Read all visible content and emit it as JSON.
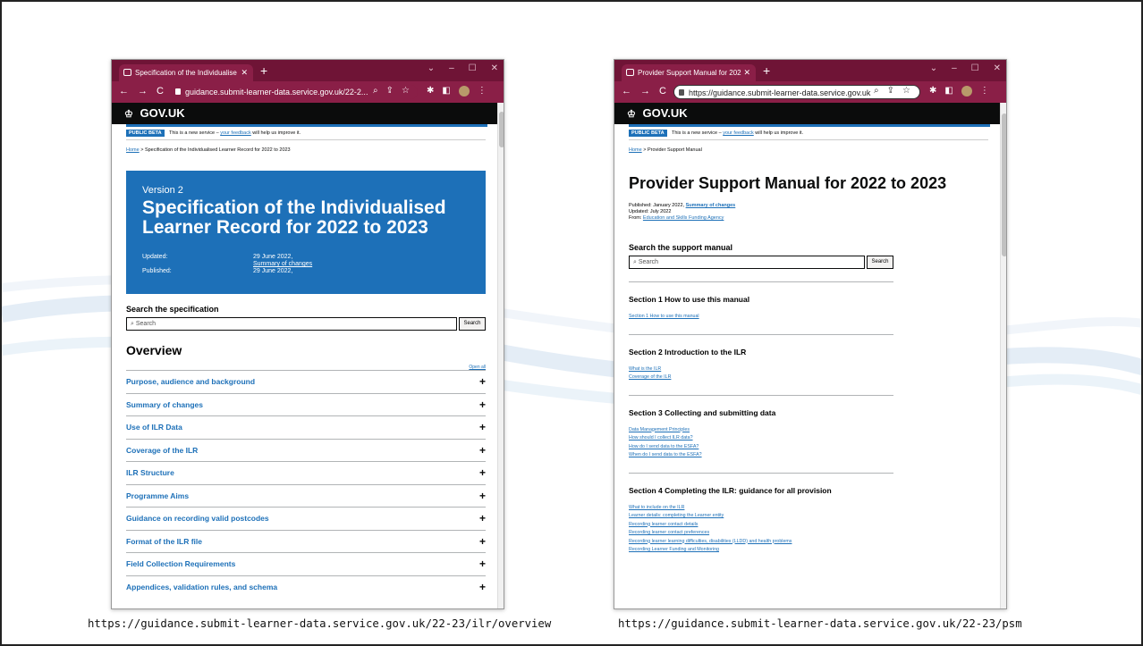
{
  "left": {
    "tab_title": "Specification of the Individualise",
    "url": "guidance.submit-learner-data.service.gov.uk/22-2...",
    "gov_logo": "GOV.UK",
    "beta_tag": "PUBLIC BETA",
    "beta_text_pre": "This is a new service –",
    "beta_link": "your feedback",
    "beta_text_post": "will help us improve it.",
    "breadcrumb_home": "Home",
    "breadcrumb_sep": ">",
    "breadcrumb_current": "Specification of the Individualised Learner Record for 2022 to 2023",
    "hero_version": "Version 2",
    "hero_title": "Specification of the Individualised Learner Record for 2022 to 2023",
    "updated_label": "Updated:",
    "updated_value": "29 June 2022,",
    "summary_link": "Summary of changes",
    "published_label": "Published:",
    "published_value": "29 June 2022,",
    "search_heading": "Search the specification",
    "search_placeholder": "Search",
    "search_button": "Search",
    "overview_heading": "Overview",
    "open_all": "Open all",
    "accordion": [
      "Purpose, audience and background",
      "Summary of changes",
      "Use of ILR Data",
      "Coverage of the ILR",
      "ILR Structure",
      "Programme Aims",
      "Guidance on recording valid postcodes",
      "Format of the ILR file",
      "Field Collection Requirements",
      "Appendices, validation rules, and schema"
    ],
    "caption": "https://guidance.submit-learner-data.service.gov.uk/22-23/ilr/overview"
  },
  "right": {
    "tab_title": "Provider Support Manual for 202",
    "url": "https://guidance.submit-learner-data.service.gov.uk",
    "gov_logo": "GOV.UK",
    "beta_tag": "PUBLIC BETA",
    "beta_text_pre": "This is a new service –",
    "beta_link": "your feedback",
    "beta_text_post": "will help us improve it.",
    "breadcrumb_home": "Home",
    "breadcrumb_sep": ">",
    "breadcrumb_current": "Provider Support Manual",
    "title": "Provider Support Manual for 2022 to 2023",
    "published": "Published: January 2022,",
    "summary_link": "Summary of changes",
    "updated": "Updated: July 2022",
    "from_label": "From:",
    "from_link": "Education and Skills Funding Agency",
    "search_heading": "Search the support manual",
    "search_placeholder": "Search",
    "search_button": "Search",
    "sections": [
      {
        "title": "Section 1 How to use this manual",
        "links": [
          "Section 1 How to use this manual"
        ]
      },
      {
        "title": "Section 2 Introduction to the ILR",
        "links": [
          "What is the ILR",
          "Coverage of the ILR"
        ]
      },
      {
        "title": "Section 3 Collecting and submitting data",
        "links": [
          "Data Management Principles",
          "How should I collect ILR data?",
          "How do I send data to the ESFA?",
          "When do I send data to the ESFA?"
        ]
      },
      {
        "title": "Section 4 Completing the ILR: guidance for all provision",
        "links": [
          "What to include on the ILR",
          "Learner details: completing the Learner entity",
          "Recording learner contact details",
          "Recording learner contact preferences",
          "Recording learner learning difficulties, disabilities (LLDD) and health problems",
          "Recording Learner Funding and Monitoring"
        ]
      }
    ],
    "caption": "https://guidance.submit-learner-data.service.gov.uk/22-23/psm"
  },
  "colors": {
    "chrome": "#8a1f47",
    "tabbar": "#6f1436",
    "gov_blue": "#1d70b8",
    "gov_black": "#0b0c0c"
  }
}
